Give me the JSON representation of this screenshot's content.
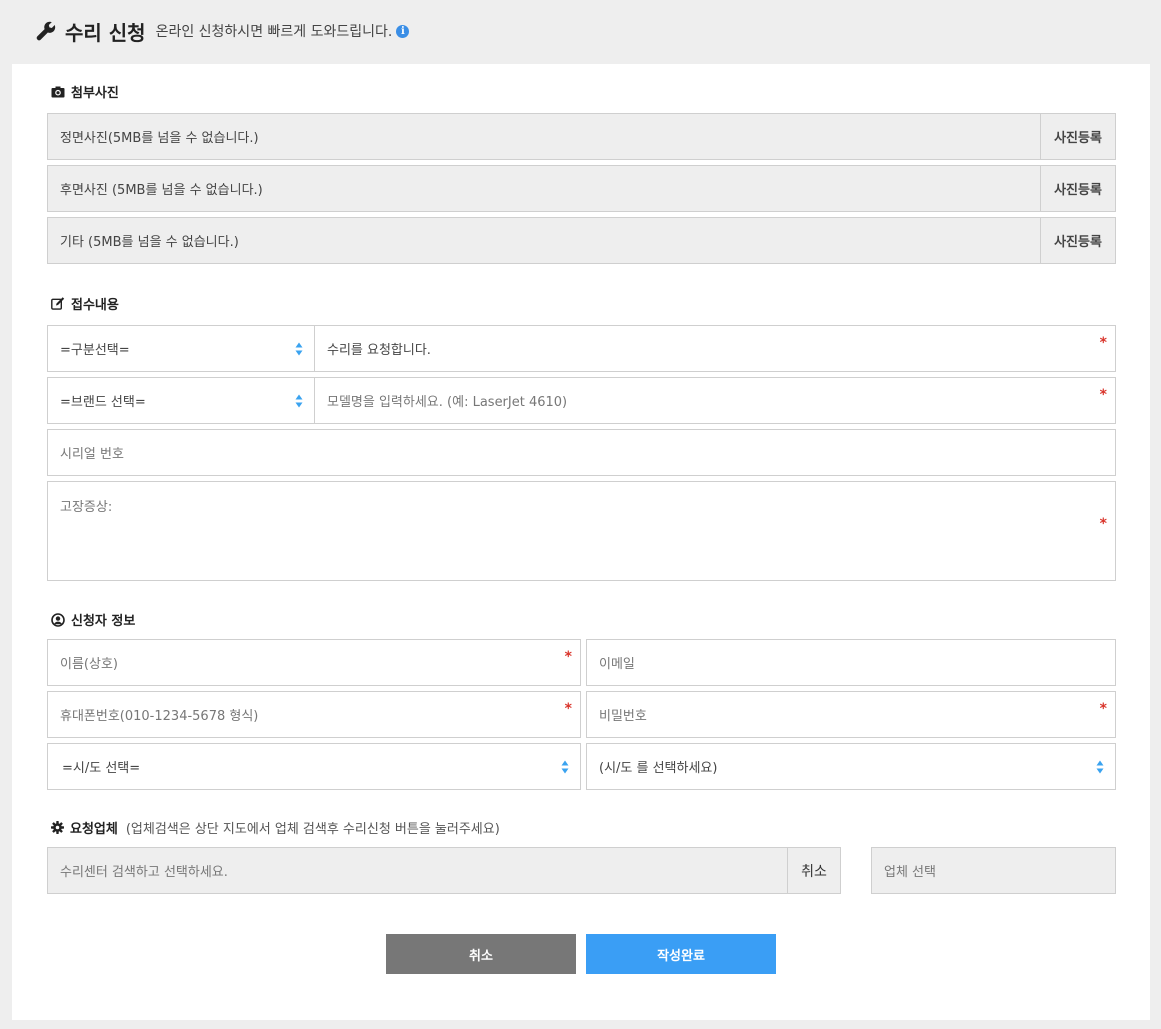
{
  "header": {
    "title": "수리 신청",
    "subtitle": "온라인 신청하시면 빠르게 도와드립니다.",
    "info_glyph": "i"
  },
  "photos": {
    "section_title": "첨부사진",
    "rows": [
      {
        "label": "정면사진(5MB를 넘을 수 없습니다.)",
        "button": "사진등록"
      },
      {
        "label": "후면사진 (5MB를 넘을 수 없습니다.)",
        "button": "사진등록"
      },
      {
        "label": "기타 (5MB를 넘을 수 없습니다.)",
        "button": "사진등록"
      }
    ]
  },
  "receipt": {
    "section_title": "접수내용",
    "category_select": "=구분선택=",
    "request_text": "수리를 요청합니다.",
    "brand_select": "=브랜드 선택=",
    "model_placeholder": "모델명을 입력하세요. (예: LaserJet 4610)",
    "serial_placeholder": "시리얼 번호",
    "symptom_placeholder": "고장증상:",
    "required_mark": "*"
  },
  "applicant": {
    "section_title": "신청자 정보",
    "name_placeholder": "이름(상호)",
    "email_placeholder": "이메일",
    "phone_placeholder": "휴대폰번호(010-1234-5678 형식)",
    "password_placeholder": "비밀번호",
    "city_select": "=시/도 선택=",
    "district_select": "(시/도 를 선택하세요)"
  },
  "vendor": {
    "section_title": "요청업체",
    "note": "(업체검색은 상단 지도에서 업체 검색후 수리신청 버튼을 눌러주세요)",
    "search_placeholder": "수리센터 검색하고 선택하세요.",
    "cancel_label": "취소",
    "vendor_placeholder": "업체 선택"
  },
  "actions": {
    "cancel": "취소",
    "submit": "작성완료"
  },
  "colors": {
    "accent": "#3a9ef5",
    "cancel_button": "#777777",
    "required": "#d9342b",
    "info_icon": "#3a8ee6"
  },
  "icons": [
    "wrench-icon",
    "info-icon",
    "camera-icon",
    "edit-icon",
    "user-circle-icon",
    "gear-icon",
    "select-arrows-icon"
  ]
}
